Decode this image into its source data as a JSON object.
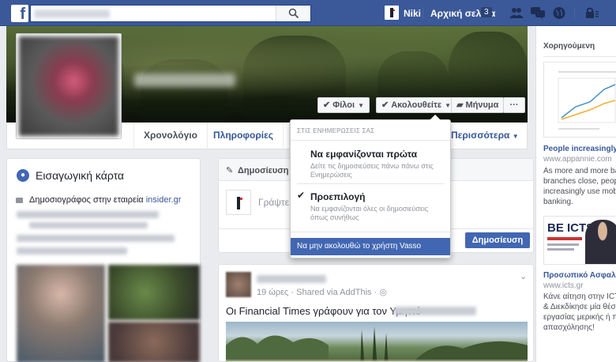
{
  "topbar": {
    "user_name": "Niki",
    "home_label": "Αρχική σελίδα",
    "home_count": "3"
  },
  "profile": {
    "buttons": {
      "friends": "Φίλοι",
      "following": "Ακολουθείτε",
      "message": "Μήνυμα",
      "more": "···"
    },
    "tabs": [
      {
        "label": "Χρονολόγιο"
      },
      {
        "label": "Πληροφορίες"
      },
      {
        "label": "Περισσότερα"
      }
    ]
  },
  "intro": {
    "title": "Εισαγωγική κάρτα",
    "job_prefix": "Δημοσιογράφος στην εταιρεία",
    "job_company": "insider.gr"
  },
  "composer": {
    "tab_label": "Δημοσίευση",
    "placeholder": "Γράψτε",
    "post_button": "Δημοσίευση"
  },
  "post": {
    "meta": "19 ώρες · Shared via AddThis · ",
    "text": "Οι Financial Times γράφουν για τον Υμηττό"
  },
  "dropdown": {
    "header": "ΣΤΙΣ ΕΝΗΜΕΡΩΣΕΙΣ ΣΑΣ",
    "option1_title": "Να εμφανίζονται πρώτα",
    "option1_desc": "Δείτε τις δημοσιεύσεις πάνω πάνω στις Ενημερώσεις",
    "option2_title": "Προεπιλογή",
    "option2_desc": "Να εμφανίζονται όλες οι δημοσιεύσεις όπως συνήθως",
    "unfollow": "Να μην ακολουθώ το χρήστη Vasso"
  },
  "sidebar": {
    "sponsored": "Χορηγούμενη",
    "ad1": {
      "title": "People increasingly us",
      "url": "www.appannie.com",
      "body_lines": [
        "As more and more bank",
        "branches close, people",
        "increasingly use mobile",
        "banking."
      ]
    },
    "ad2": {
      "logo": "BE ICTS",
      "title": "Προσωπικό Ασφαλεία",
      "url": "www.icts.gr",
      "body_lines": [
        "Κάνε αίτηση στην ICTS H",
        "& Διεκδίκησε μία θέση",
        "εργασίας μερικής ή πλήρ",
        "απασχόλησης!"
      ]
    }
  },
  "colors": {
    "brand": "#3b5998",
    "link": "#365899",
    "button_primary": "#4267b2"
  }
}
